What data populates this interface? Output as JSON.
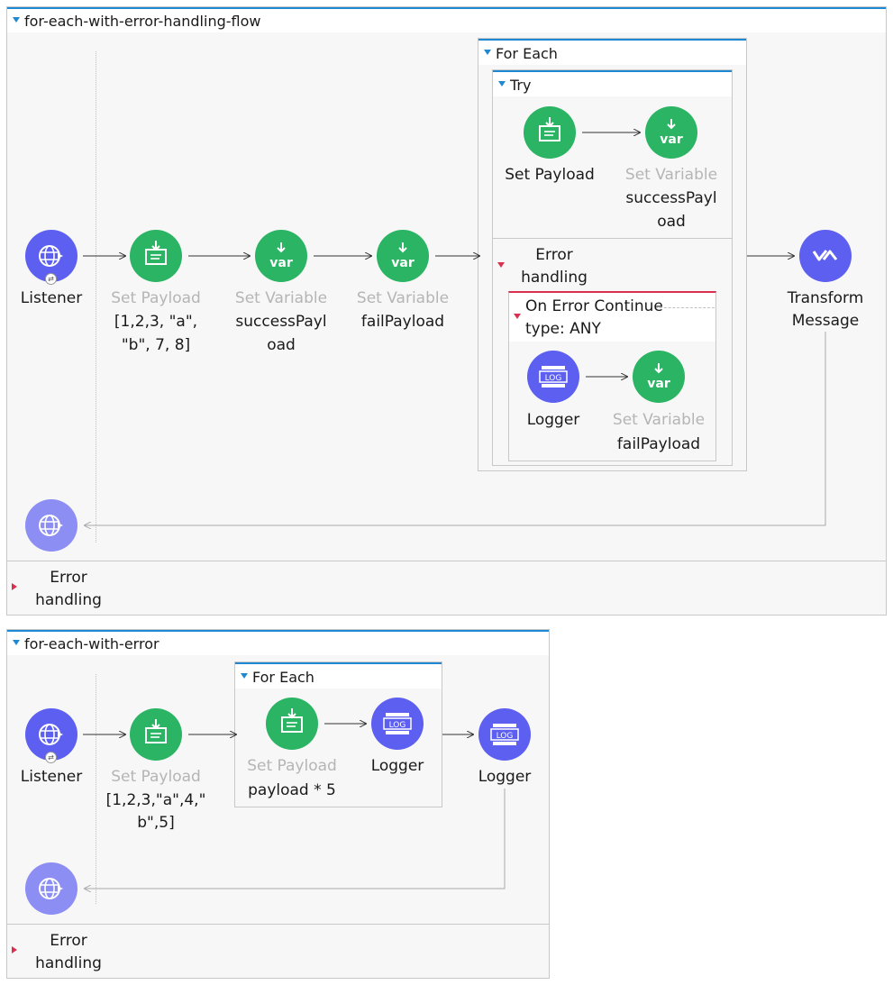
{
  "colors": {
    "accent": "#1e88d2",
    "green": "#2ab463",
    "blue": "#5c5ff0",
    "error": "#d9304f"
  },
  "flow1": {
    "title": "for-each-with-error-handling-flow",
    "listener_label": "Listener",
    "set_payload": {
      "type": "Set Payload",
      "line1": "[1,2,3, \"a\",",
      "line2": "\"b\", 7, 8]"
    },
    "set_var_success": {
      "type": "Set Variable",
      "line1": "successPayl",
      "line2": "oad"
    },
    "set_var_fail": {
      "type": "Set Variable",
      "line1": "failPayload"
    },
    "for_each": {
      "title": "For Each",
      "try": {
        "title": "Try",
        "set_payload_label": "Set Payload",
        "set_var_type": "Set Variable",
        "set_var_line1": "successPayl",
        "set_var_line2": "oad",
        "error_line1": "Error",
        "error_line2": "handling",
        "on_error": {
          "title": "On Error Continue",
          "subtitle": "type: ANY",
          "logger_label": "Logger",
          "set_var_type": "Set Variable",
          "set_var_name": "failPayload"
        }
      }
    },
    "transform": {
      "line1": "Transform",
      "line2": "Message"
    },
    "error_line1": "Error",
    "error_line2": "handling"
  },
  "flow2": {
    "title": "for-each-with-error",
    "listener_label": "Listener",
    "set_payload": {
      "type": "Set Payload",
      "line1": "[1,2,3,\"a\",4,\"",
      "line2": "b\",5]"
    },
    "for_each": {
      "title": "For Each",
      "set_payload_type": "Set Payload",
      "set_payload_value": "payload * 5",
      "logger_label": "Logger"
    },
    "logger_label": "Logger",
    "error_line1": "Error",
    "error_line2": "handling"
  },
  "icons": [
    "globe-icon",
    "set-payload-icon",
    "var-icon",
    "log-icon",
    "transform-icon"
  ]
}
